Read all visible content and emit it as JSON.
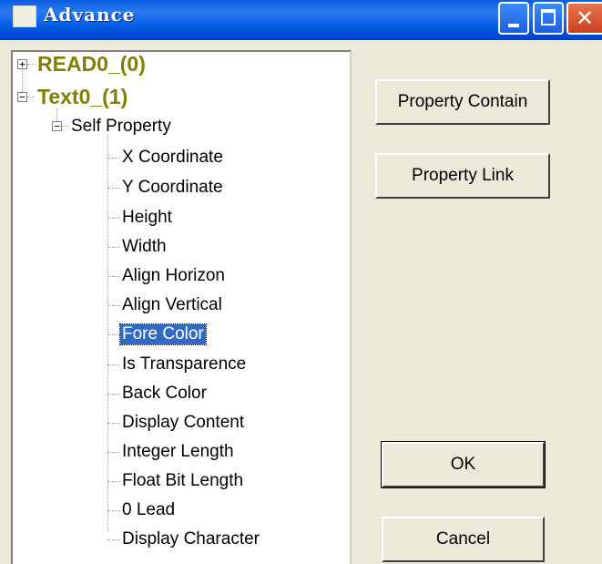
{
  "window": {
    "title": "Advance"
  },
  "tree": {
    "roots": [
      {
        "label": "READ0_(0)",
        "expanded": false,
        "expander": "+"
      },
      {
        "label": "Text0_(1)",
        "expanded": true,
        "expander": "−"
      }
    ],
    "group": {
      "label": "Self Property",
      "expander": "−"
    },
    "items": [
      "X Coordinate",
      "Y Coordinate",
      "Height",
      "Width",
      "Align Horizon",
      "Align Vertical",
      "Fore Color",
      "Is Transparence",
      "Back Color",
      "Display Content",
      "Integer Length",
      "Float Bit Length",
      "0 Lead",
      "Display Character"
    ],
    "selected_item": "Fore Color"
  },
  "buttons": {
    "property_contain": "Property Contain",
    "property_link": "Property Link",
    "ok": "OK",
    "cancel": "Cancel"
  }
}
